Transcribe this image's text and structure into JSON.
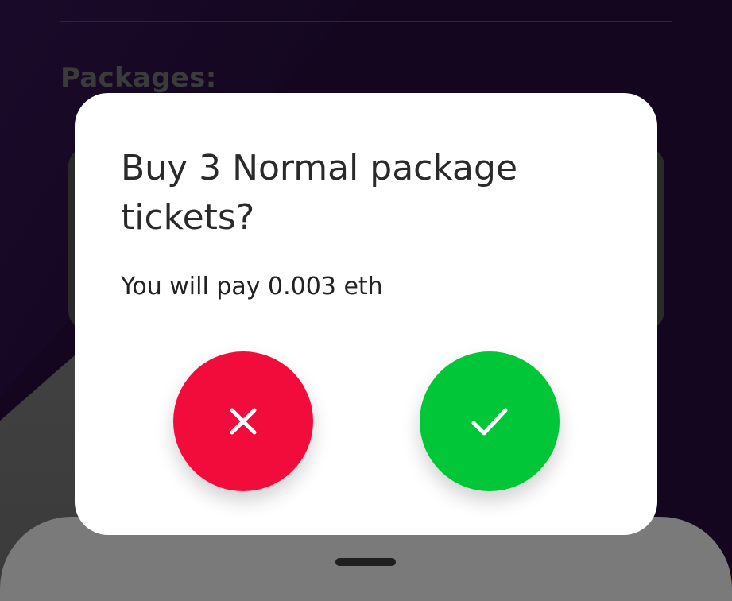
{
  "background": {
    "section_title": "Packages:",
    "bottom_sheet": {
      "handle": "handle"
    }
  },
  "modal": {
    "title": "Buy 3 Normal package tickets?",
    "subtitle": "You will pay 0.003 eth",
    "buttons": {
      "cancel": {
        "icon": "close-icon",
        "color": "#f20c3c"
      },
      "confirm": {
        "icon": "check-icon",
        "color": "#00c638"
      }
    }
  }
}
